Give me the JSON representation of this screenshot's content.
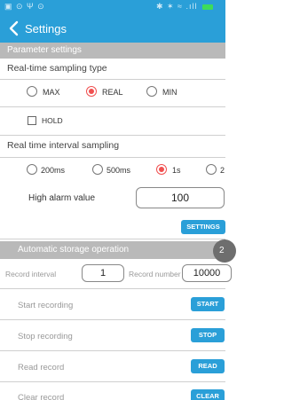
{
  "status_bar": {
    "left_icons": "▣ ⊙ Ψ ⊙",
    "right_icons": "✱ ✶ ≈ .ıll",
    "battery": "1"
  },
  "app_bar": {
    "title": "Settings"
  },
  "parameter": {
    "group_title": "Parameter settings",
    "sampling_type": {
      "title": "Real-time sampling type",
      "options": [
        "MAX",
        "REAL",
        "MIN"
      ],
      "selected": "REAL"
    },
    "hold_label": "HOLD",
    "interval": {
      "title": "Real time interval sampling",
      "options": [
        "200ms",
        "500ms",
        "1s",
        "2"
      ],
      "selected": "1s"
    },
    "high_alarm": {
      "label": "High alarm value",
      "value": "100"
    },
    "settings_button": "SETTINGS"
  },
  "storage": {
    "group_title": "Automatic storage operation",
    "record_interval": {
      "label": "Record interval",
      "value": "1"
    },
    "record_number": {
      "label": "Record number",
      "value": "10000"
    },
    "fab_label": "2",
    "actions": [
      {
        "label": "Start recording",
        "button": "START"
      },
      {
        "label": "Stop recording",
        "button": "STOP"
      },
      {
        "label": "Read record",
        "button": "READ"
      },
      {
        "label": "Clear record",
        "button": "CLEAR"
      }
    ]
  },
  "colors": {
    "accent": "#2a9fd8",
    "radio_selected": "#f05050",
    "group_header": "#b9b9b9"
  }
}
